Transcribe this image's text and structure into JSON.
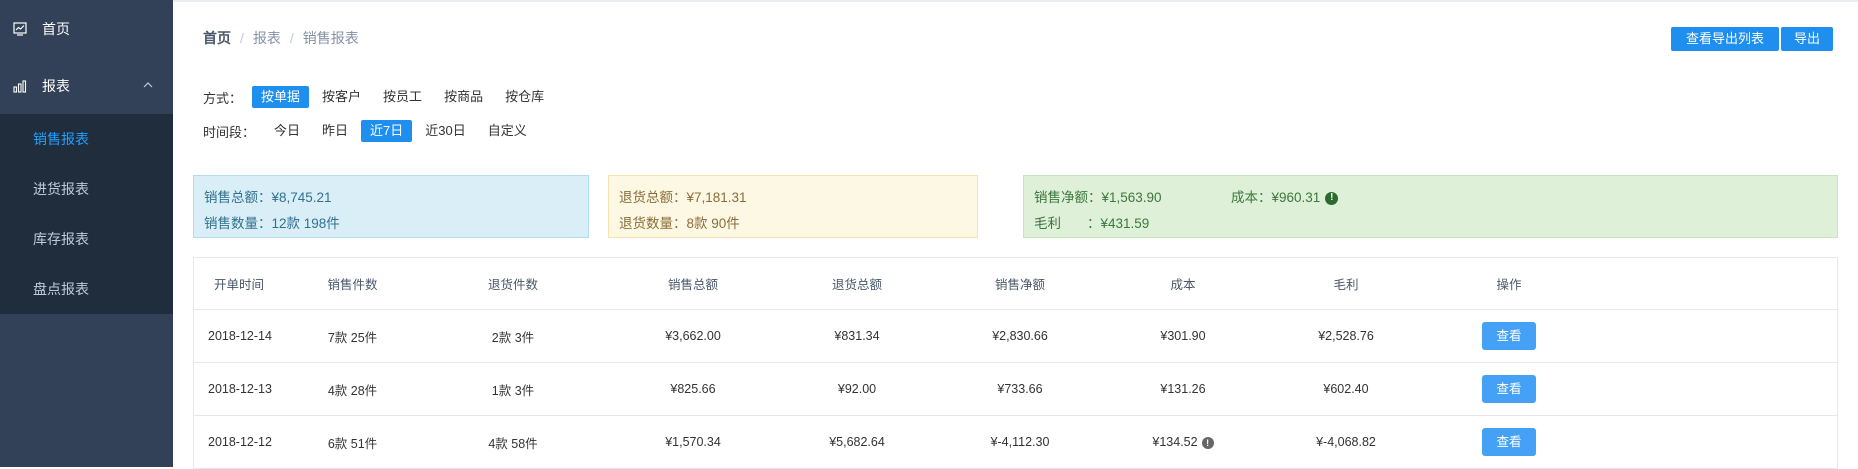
{
  "sidebar": {
    "home": {
      "label": "首页",
      "icon": "chart-line-icon"
    },
    "report": {
      "label": "报表",
      "icon": "bar-chart-icon"
    },
    "sub_items": [
      {
        "label": "销售报表",
        "active": true
      },
      {
        "label": "进货报表",
        "active": false
      },
      {
        "label": "库存报表",
        "active": false
      },
      {
        "label": "盘点报表",
        "active": false
      }
    ]
  },
  "breadcrumb": [
    "首页",
    "报表",
    "销售报表"
  ],
  "toolbar": {
    "view_export_list": "查看导出列表",
    "export": "导出"
  },
  "filters": {
    "mode_label": "方式：",
    "modes": [
      {
        "label": "按单据",
        "selected": true
      },
      {
        "label": "按客户",
        "selected": false
      },
      {
        "label": "按员工",
        "selected": false
      },
      {
        "label": "按商品",
        "selected": false
      },
      {
        "label": "按仓库",
        "selected": false
      }
    ],
    "period_label": "时间段：",
    "periods": [
      {
        "label": "今日",
        "selected": false
      },
      {
        "label": "昨日",
        "selected": false
      },
      {
        "label": "近7日",
        "selected": true
      },
      {
        "label": "近30日",
        "selected": false
      },
      {
        "label": "自定义",
        "selected": false
      }
    ]
  },
  "summary": {
    "sales_total": "销售总额：¥8,745.21",
    "sales_qty": "销售数量：12款 198件",
    "return_total": "退货总额：¥7,181.31",
    "return_qty": "退货数量：8款 90件",
    "net_sales": "销售净额：¥1,563.90",
    "cost": "成本：¥960.31",
    "gross_profit_label": "毛利",
    "gross_profit_value": "：¥431.59"
  },
  "table": {
    "headers": [
      "开单时间",
      "销售件数",
      "退货件数",
      "销售总额",
      "退货总额",
      "销售净额",
      "成本",
      "毛利",
      "操作"
    ],
    "rows": [
      {
        "date": "2018-12-14",
        "sales_qty": "7款 25件",
        "return_qty": "2款 3件",
        "sales_total": "¥3,662.00",
        "return_total": "¥831.34",
        "net": "¥2,830.66",
        "cost": "¥301.90",
        "cost_warning": false,
        "profit": "¥2,528.76",
        "action": "查看"
      },
      {
        "date": "2018-12-13",
        "sales_qty": "4款 28件",
        "return_qty": "1款 3件",
        "sales_total": "¥825.66",
        "return_total": "¥92.00",
        "net": "¥733.66",
        "cost": "¥131.26",
        "cost_warning": false,
        "profit": "¥602.40",
        "action": "查看"
      },
      {
        "date": "2018-12-12",
        "sales_qty": "6款 51件",
        "return_qty": "4款 58件",
        "sales_total": "¥1,570.34",
        "return_total": "¥5,682.64",
        "net": "¥-4,112.30",
        "cost": "¥134.52",
        "cost_warning": true,
        "profit": "¥-4,068.82",
        "action": "查看"
      }
    ]
  },
  "colors": {
    "sidebar_bg": "#324157",
    "submenu_bg": "#1f2d3d",
    "accent": "#1e8fef",
    "active_text": "#20a0ff"
  }
}
